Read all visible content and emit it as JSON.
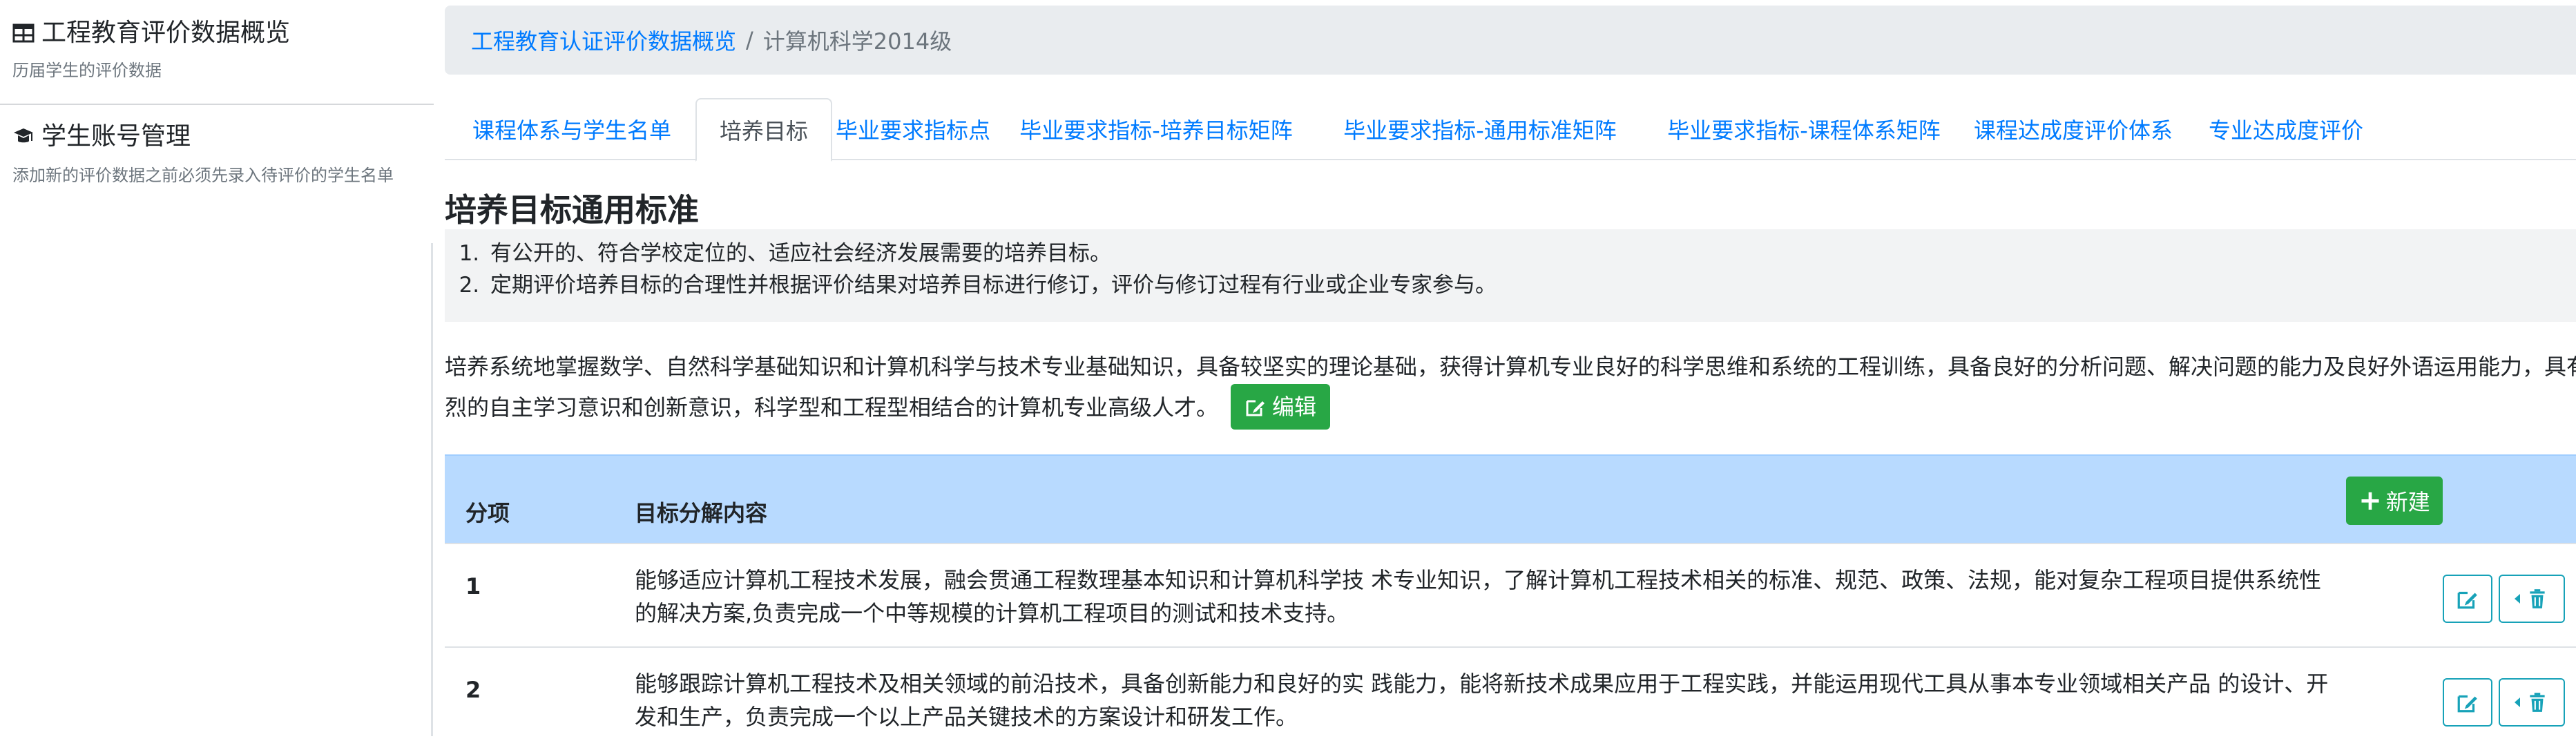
{
  "sidebar": {
    "items": [
      {
        "title": "工程教育评价数据概览",
        "desc": "历届学生的评价数据",
        "icon": "table-icon"
      },
      {
        "title": "学生账号管理",
        "desc": "添加新的评价数据之前必须先录入待评价的学生名单",
        "icon": "graduation-cap-icon"
      }
    ]
  },
  "breadcrumb": {
    "root": "工程教育认证评价数据概览",
    "separator": "/",
    "current": "计算机科学2014级"
  },
  "tabs": [
    {
      "label": "课程体系与学生名单"
    },
    {
      "label": "培养目标",
      "active": true
    },
    {
      "label": "毕业要求指标点"
    },
    {
      "label": "毕业要求指标-培养目标矩阵"
    },
    {
      "label": "毕业要求指标-通用标准矩阵"
    },
    {
      "label": "毕业要求指标-课程体系矩阵"
    },
    {
      "label": "课程达成度评价体系"
    },
    {
      "label": "专业达成度评价"
    }
  ],
  "standard": {
    "title": "培养目标通用标准",
    "items": [
      "有公开的、符合学校定位的、适应社会经济发展需要的培养目标。",
      "定期评价培养目标的合理性并根据评价结果对培养目标进行修订，评价与修订过程有行业或企业专家参与。"
    ]
  },
  "objective": {
    "line1": "培养系统地掌握数学、自然科学基础知识和计算机科学与技术专业基础知识，具备较坚实的理论基础，获得计算机专业良好的科学思维和系统的工程训练，具备良好的分析问题、解决问题的能力及良好外语运用能力，具有强",
    "line2": "烈的自主学习意识和创新意识，科学型和工程型相结合的计算机专业高级人才。",
    "edit_label": "编辑"
  },
  "table": {
    "headers": {
      "index": "分项",
      "content": "目标分解内容"
    },
    "new_label": "新建",
    "rows": [
      {
        "index": "1",
        "line1": "能够适应计算机工程技术发展，融会贯通工程数理基本知识和计算机科学技 术专业知识，了解计算机工程技术相关的标准、规范、政策、法规，能对复杂工程项目提供系统性",
        "line2": "的解决方案,负责完成一个中等规模的计算机工程项目的测试和技术支持。"
      },
      {
        "index": "2",
        "line1": "能够跟踪计算机工程技术及相关领域的前沿技术，具备创新能力和良好的实 践能力，能将新技术成果应用于工程实践，并能运用现代工具从事本专业领域相关产品 的设计、开",
        "line2": "发和生产，负责完成一个以上产品关键技术的方案设计和研发工作。"
      }
    ]
  },
  "colors": {
    "accent": "#007bff",
    "success": "#28a745",
    "info": "#17a2b8",
    "table_head": "#b8daff"
  }
}
